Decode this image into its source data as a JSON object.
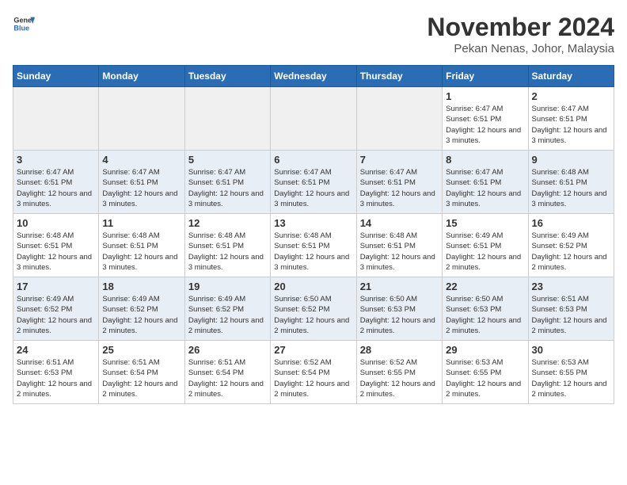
{
  "header": {
    "logo_line1": "General",
    "logo_line2": "Blue",
    "month": "November 2024",
    "location": "Pekan Nenas, Johor, Malaysia"
  },
  "days_of_week": [
    "Sunday",
    "Monday",
    "Tuesday",
    "Wednesday",
    "Thursday",
    "Friday",
    "Saturday"
  ],
  "weeks": [
    [
      {
        "day": "",
        "info": "",
        "empty": true
      },
      {
        "day": "",
        "info": "",
        "empty": true
      },
      {
        "day": "",
        "info": "",
        "empty": true
      },
      {
        "day": "",
        "info": "",
        "empty": true
      },
      {
        "day": "",
        "info": "",
        "empty": true
      },
      {
        "day": "1",
        "info": "Sunrise: 6:47 AM\nSunset: 6:51 PM\nDaylight: 12 hours and 3 minutes.",
        "empty": false
      },
      {
        "day": "2",
        "info": "Sunrise: 6:47 AM\nSunset: 6:51 PM\nDaylight: 12 hours and 3 minutes.",
        "empty": false
      }
    ],
    [
      {
        "day": "3",
        "info": "Sunrise: 6:47 AM\nSunset: 6:51 PM\nDaylight: 12 hours and 3 minutes.",
        "empty": false
      },
      {
        "day": "4",
        "info": "Sunrise: 6:47 AM\nSunset: 6:51 PM\nDaylight: 12 hours and 3 minutes.",
        "empty": false
      },
      {
        "day": "5",
        "info": "Sunrise: 6:47 AM\nSunset: 6:51 PM\nDaylight: 12 hours and 3 minutes.",
        "empty": false
      },
      {
        "day": "6",
        "info": "Sunrise: 6:47 AM\nSunset: 6:51 PM\nDaylight: 12 hours and 3 minutes.",
        "empty": false
      },
      {
        "day": "7",
        "info": "Sunrise: 6:47 AM\nSunset: 6:51 PM\nDaylight: 12 hours and 3 minutes.",
        "empty": false
      },
      {
        "day": "8",
        "info": "Sunrise: 6:47 AM\nSunset: 6:51 PM\nDaylight: 12 hours and 3 minutes.",
        "empty": false
      },
      {
        "day": "9",
        "info": "Sunrise: 6:48 AM\nSunset: 6:51 PM\nDaylight: 12 hours and 3 minutes.",
        "empty": false
      }
    ],
    [
      {
        "day": "10",
        "info": "Sunrise: 6:48 AM\nSunset: 6:51 PM\nDaylight: 12 hours and 3 minutes.",
        "empty": false
      },
      {
        "day": "11",
        "info": "Sunrise: 6:48 AM\nSunset: 6:51 PM\nDaylight: 12 hours and 3 minutes.",
        "empty": false
      },
      {
        "day": "12",
        "info": "Sunrise: 6:48 AM\nSunset: 6:51 PM\nDaylight: 12 hours and 3 minutes.",
        "empty": false
      },
      {
        "day": "13",
        "info": "Sunrise: 6:48 AM\nSunset: 6:51 PM\nDaylight: 12 hours and 3 minutes.",
        "empty": false
      },
      {
        "day": "14",
        "info": "Sunrise: 6:48 AM\nSunset: 6:51 PM\nDaylight: 12 hours and 3 minutes.",
        "empty": false
      },
      {
        "day": "15",
        "info": "Sunrise: 6:49 AM\nSunset: 6:51 PM\nDaylight: 12 hours and 2 minutes.",
        "empty": false
      },
      {
        "day": "16",
        "info": "Sunrise: 6:49 AM\nSunset: 6:52 PM\nDaylight: 12 hours and 2 minutes.",
        "empty": false
      }
    ],
    [
      {
        "day": "17",
        "info": "Sunrise: 6:49 AM\nSunset: 6:52 PM\nDaylight: 12 hours and 2 minutes.",
        "empty": false
      },
      {
        "day": "18",
        "info": "Sunrise: 6:49 AM\nSunset: 6:52 PM\nDaylight: 12 hours and 2 minutes.",
        "empty": false
      },
      {
        "day": "19",
        "info": "Sunrise: 6:49 AM\nSunset: 6:52 PM\nDaylight: 12 hours and 2 minutes.",
        "empty": false
      },
      {
        "day": "20",
        "info": "Sunrise: 6:50 AM\nSunset: 6:52 PM\nDaylight: 12 hours and 2 minutes.",
        "empty": false
      },
      {
        "day": "21",
        "info": "Sunrise: 6:50 AM\nSunset: 6:53 PM\nDaylight: 12 hours and 2 minutes.",
        "empty": false
      },
      {
        "day": "22",
        "info": "Sunrise: 6:50 AM\nSunset: 6:53 PM\nDaylight: 12 hours and 2 minutes.",
        "empty": false
      },
      {
        "day": "23",
        "info": "Sunrise: 6:51 AM\nSunset: 6:53 PM\nDaylight: 12 hours and 2 minutes.",
        "empty": false
      }
    ],
    [
      {
        "day": "24",
        "info": "Sunrise: 6:51 AM\nSunset: 6:53 PM\nDaylight: 12 hours and 2 minutes.",
        "empty": false
      },
      {
        "day": "25",
        "info": "Sunrise: 6:51 AM\nSunset: 6:54 PM\nDaylight: 12 hours and 2 minutes.",
        "empty": false
      },
      {
        "day": "26",
        "info": "Sunrise: 6:51 AM\nSunset: 6:54 PM\nDaylight: 12 hours and 2 minutes.",
        "empty": false
      },
      {
        "day": "27",
        "info": "Sunrise: 6:52 AM\nSunset: 6:54 PM\nDaylight: 12 hours and 2 minutes.",
        "empty": false
      },
      {
        "day": "28",
        "info": "Sunrise: 6:52 AM\nSunset: 6:55 PM\nDaylight: 12 hours and 2 minutes.",
        "empty": false
      },
      {
        "day": "29",
        "info": "Sunrise: 6:53 AM\nSunset: 6:55 PM\nDaylight: 12 hours and 2 minutes.",
        "empty": false
      },
      {
        "day": "30",
        "info": "Sunrise: 6:53 AM\nSunset: 6:55 PM\nDaylight: 12 hours and 2 minutes.",
        "empty": false
      }
    ]
  ]
}
